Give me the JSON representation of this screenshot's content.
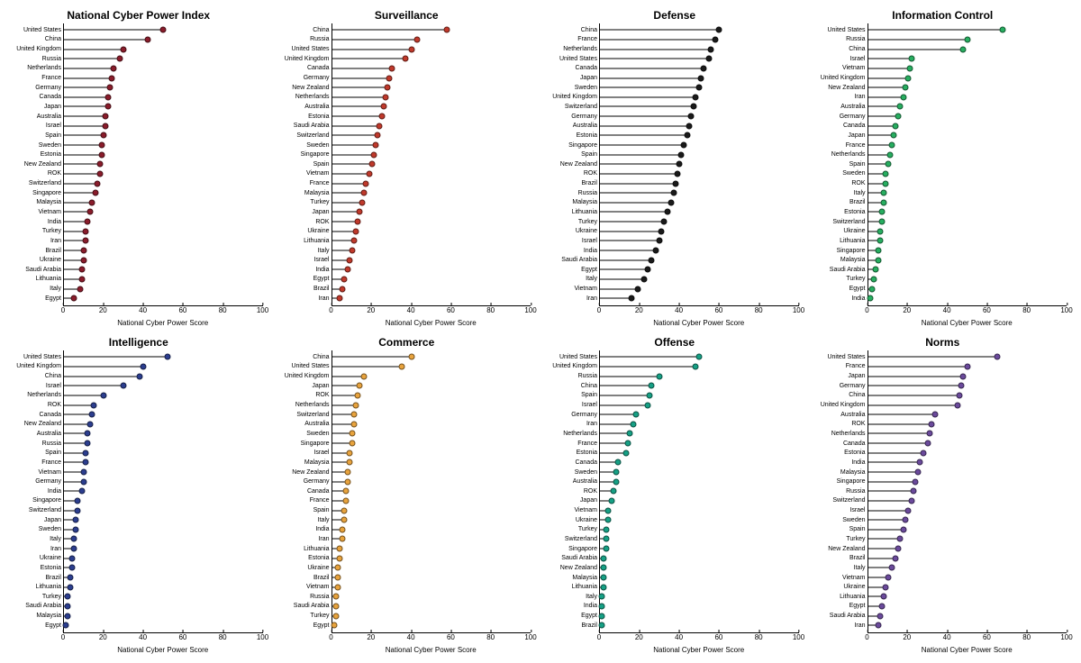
{
  "xlabel": "National Cyber Power Score",
  "xmax": 100,
  "ticks": [
    0,
    20,
    40,
    60,
    80,
    100
  ],
  "chart_data": [
    {
      "title": "National Cyber Power Index",
      "color": "#8a1c2b",
      "type": "lollipop",
      "xlabel": "National Cyber Power Score",
      "xlim": [
        0,
        100
      ],
      "series": [
        {
          "name": "United States",
          "value": 50
        },
        {
          "name": "China",
          "value": 42
        },
        {
          "name": "United Kingdom",
          "value": 30
        },
        {
          "name": "Russia",
          "value": 28
        },
        {
          "name": "Netherlands",
          "value": 25
        },
        {
          "name": "France",
          "value": 24
        },
        {
          "name": "Germany",
          "value": 23
        },
        {
          "name": "Canada",
          "value": 22
        },
        {
          "name": "Japan",
          "value": 22
        },
        {
          "name": "Australia",
          "value": 21
        },
        {
          "name": "Israel",
          "value": 21
        },
        {
          "name": "Spain",
          "value": 20
        },
        {
          "name": "Sweden",
          "value": 19
        },
        {
          "name": "Estonia",
          "value": 19
        },
        {
          "name": "New Zealand",
          "value": 18
        },
        {
          "name": "ROK",
          "value": 18
        },
        {
          "name": "Switzerland",
          "value": 17
        },
        {
          "name": "Singapore",
          "value": 16
        },
        {
          "name": "Malaysia",
          "value": 14
        },
        {
          "name": "Vietnam",
          "value": 13
        },
        {
          "name": "India",
          "value": 12
        },
        {
          "name": "Turkey",
          "value": 11
        },
        {
          "name": "Iran",
          "value": 11
        },
        {
          "name": "Brazil",
          "value": 10
        },
        {
          "name": "Ukraine",
          "value": 10
        },
        {
          "name": "Saudi Arabia",
          "value": 9
        },
        {
          "name": "Lithuania",
          "value": 9
        },
        {
          "name": "Italy",
          "value": 8
        },
        {
          "name": "Egypt",
          "value": 5
        }
      ]
    },
    {
      "title": "Surveillance",
      "color": "#c0392b",
      "type": "lollipop",
      "xlabel": "National Cyber Power Score",
      "xlim": [
        0,
        100
      ],
      "series": [
        {
          "name": "China",
          "value": 58
        },
        {
          "name": "Russia",
          "value": 43
        },
        {
          "name": "United States",
          "value": 40
        },
        {
          "name": "United Kingdom",
          "value": 37
        },
        {
          "name": "Canada",
          "value": 30
        },
        {
          "name": "Germany",
          "value": 29
        },
        {
          "name": "New Zealand",
          "value": 28
        },
        {
          "name": "Netherlands",
          "value": 27
        },
        {
          "name": "Australia",
          "value": 26
        },
        {
          "name": "Estonia",
          "value": 25
        },
        {
          "name": "Saudi Arabia",
          "value": 24
        },
        {
          "name": "Switzerland",
          "value": 23
        },
        {
          "name": "Sweden",
          "value": 22
        },
        {
          "name": "Singapore",
          "value": 21
        },
        {
          "name": "Spain",
          "value": 20
        },
        {
          "name": "Vietnam",
          "value": 19
        },
        {
          "name": "France",
          "value": 17
        },
        {
          "name": "Malaysia",
          "value": 16
        },
        {
          "name": "Turkey",
          "value": 15
        },
        {
          "name": "Japan",
          "value": 14
        },
        {
          "name": "ROK",
          "value": 13
        },
        {
          "name": "Ukraine",
          "value": 12
        },
        {
          "name": "Lithuania",
          "value": 11
        },
        {
          "name": "Italy",
          "value": 10
        },
        {
          "name": "Israel",
          "value": 9
        },
        {
          "name": "India",
          "value": 8
        },
        {
          "name": "Egypt",
          "value": 6
        },
        {
          "name": "Brazil",
          "value": 5
        },
        {
          "name": "Iran",
          "value": 4
        }
      ]
    },
    {
      "title": "Defense",
      "color": "#1a1a1a",
      "type": "lollipop",
      "xlabel": "National Cyber Power Score",
      "xlim": [
        0,
        100
      ],
      "series": [
        {
          "name": "China",
          "value": 60
        },
        {
          "name": "France",
          "value": 58
        },
        {
          "name": "Netherlands",
          "value": 56
        },
        {
          "name": "United States",
          "value": 55
        },
        {
          "name": "Canada",
          "value": 52
        },
        {
          "name": "Japan",
          "value": 51
        },
        {
          "name": "Sweden",
          "value": 50
        },
        {
          "name": "United Kingdom",
          "value": 48
        },
        {
          "name": "Switzerland",
          "value": 47
        },
        {
          "name": "Germany",
          "value": 46
        },
        {
          "name": "Australia",
          "value": 45
        },
        {
          "name": "Estonia",
          "value": 44
        },
        {
          "name": "Singapore",
          "value": 42
        },
        {
          "name": "Spain",
          "value": 41
        },
        {
          "name": "New Zealand",
          "value": 40
        },
        {
          "name": "ROK",
          "value": 39
        },
        {
          "name": "Brazil",
          "value": 38
        },
        {
          "name": "Russia",
          "value": 37
        },
        {
          "name": "Malaysia",
          "value": 36
        },
        {
          "name": "Lithuania",
          "value": 34
        },
        {
          "name": "Turkey",
          "value": 32
        },
        {
          "name": "Ukraine",
          "value": 31
        },
        {
          "name": "Israel",
          "value": 30
        },
        {
          "name": "India",
          "value": 28
        },
        {
          "name": "Saudi Arabia",
          "value": 26
        },
        {
          "name": "Egypt",
          "value": 24
        },
        {
          "name": "Italy",
          "value": 22
        },
        {
          "name": "Vietnam",
          "value": 19
        },
        {
          "name": "Iran",
          "value": 16
        }
      ]
    },
    {
      "title": "Information Control",
      "color": "#27ae60",
      "type": "lollipop",
      "xlabel": "National Cyber Power Score",
      "xlim": [
        0,
        100
      ],
      "series": [
        {
          "name": "United States",
          "value": 68
        },
        {
          "name": "Russia",
          "value": 50
        },
        {
          "name": "China",
          "value": 48
        },
        {
          "name": "Israel",
          "value": 22
        },
        {
          "name": "Vietnam",
          "value": 21
        },
        {
          "name": "United Kingdom",
          "value": 20
        },
        {
          "name": "New Zealand",
          "value": 19
        },
        {
          "name": "Iran",
          "value": 18
        },
        {
          "name": "Australia",
          "value": 16
        },
        {
          "name": "Germany",
          "value": 15
        },
        {
          "name": "Canada",
          "value": 14
        },
        {
          "name": "Japan",
          "value": 13
        },
        {
          "name": "France",
          "value": 12
        },
        {
          "name": "Netherlands",
          "value": 11
        },
        {
          "name": "Spain",
          "value": 10
        },
        {
          "name": "Sweden",
          "value": 9
        },
        {
          "name": "ROK",
          "value": 9
        },
        {
          "name": "Italy",
          "value": 8
        },
        {
          "name": "Brazil",
          "value": 8
        },
        {
          "name": "Estonia",
          "value": 7
        },
        {
          "name": "Switzerland",
          "value": 7
        },
        {
          "name": "Ukraine",
          "value": 6
        },
        {
          "name": "Lithuania",
          "value": 6
        },
        {
          "name": "Singapore",
          "value": 5
        },
        {
          "name": "Malaysia",
          "value": 5
        },
        {
          "name": "Saudi Arabia",
          "value": 4
        },
        {
          "name": "Turkey",
          "value": 3
        },
        {
          "name": "Egypt",
          "value": 2
        },
        {
          "name": "India",
          "value": 1
        }
      ]
    },
    {
      "title": "Intelligence",
      "color": "#2c3e8f",
      "type": "lollipop",
      "xlabel": "National Cyber Power Score",
      "xlim": [
        0,
        100
      ],
      "series": [
        {
          "name": "United States",
          "value": 52
        },
        {
          "name": "United Kingdom",
          "value": 40
        },
        {
          "name": "China",
          "value": 38
        },
        {
          "name": "Israel",
          "value": 30
        },
        {
          "name": "Netherlands",
          "value": 20
        },
        {
          "name": "ROK",
          "value": 15
        },
        {
          "name": "Canada",
          "value": 14
        },
        {
          "name": "New Zealand",
          "value": 13
        },
        {
          "name": "Australia",
          "value": 12
        },
        {
          "name": "Russia",
          "value": 12
        },
        {
          "name": "Spain",
          "value": 11
        },
        {
          "name": "France",
          "value": 11
        },
        {
          "name": "Vietnam",
          "value": 10
        },
        {
          "name": "Germany",
          "value": 10
        },
        {
          "name": "India",
          "value": 9
        },
        {
          "name": "Singapore",
          "value": 7
        },
        {
          "name": "Switzerland",
          "value": 7
        },
        {
          "name": "Japan",
          "value": 6
        },
        {
          "name": "Sweden",
          "value": 6
        },
        {
          "name": "Italy",
          "value": 5
        },
        {
          "name": "Iran",
          "value": 5
        },
        {
          "name": "Ukraine",
          "value": 4
        },
        {
          "name": "Estonia",
          "value": 4
        },
        {
          "name": "Brazil",
          "value": 3
        },
        {
          "name": "Lithuania",
          "value": 3
        },
        {
          "name": "Turkey",
          "value": 2
        },
        {
          "name": "Saudi Arabia",
          "value": 2
        },
        {
          "name": "Malaysia",
          "value": 2
        },
        {
          "name": "Egypt",
          "value": 1
        }
      ]
    },
    {
      "title": "Commerce",
      "color": "#e8a33d",
      "type": "lollipop",
      "xlabel": "National Cyber Power Score",
      "xlim": [
        0,
        100
      ],
      "series": [
        {
          "name": "China",
          "value": 40
        },
        {
          "name": "United States",
          "value": 35
        },
        {
          "name": "United Kingdom",
          "value": 16
        },
        {
          "name": "Japan",
          "value": 14
        },
        {
          "name": "ROK",
          "value": 13
        },
        {
          "name": "Netherlands",
          "value": 12
        },
        {
          "name": "Switzerland",
          "value": 11
        },
        {
          "name": "Australia",
          "value": 11
        },
        {
          "name": "Sweden",
          "value": 10
        },
        {
          "name": "Singapore",
          "value": 10
        },
        {
          "name": "Israel",
          "value": 9
        },
        {
          "name": "Malaysia",
          "value": 9
        },
        {
          "name": "New Zealand",
          "value": 8
        },
        {
          "name": "Germany",
          "value": 8
        },
        {
          "name": "Canada",
          "value": 7
        },
        {
          "name": "France",
          "value": 7
        },
        {
          "name": "Spain",
          "value": 6
        },
        {
          "name": "Italy",
          "value": 6
        },
        {
          "name": "India",
          "value": 5
        },
        {
          "name": "Iran",
          "value": 5
        },
        {
          "name": "Lithuania",
          "value": 4
        },
        {
          "name": "Estonia",
          "value": 4
        },
        {
          "name": "Ukraine",
          "value": 3
        },
        {
          "name": "Brazil",
          "value": 3
        },
        {
          "name": "Vietnam",
          "value": 3
        },
        {
          "name": "Russia",
          "value": 2
        },
        {
          "name": "Saudi Arabia",
          "value": 2
        },
        {
          "name": "Turkey",
          "value": 2
        },
        {
          "name": "Egypt",
          "value": 1
        }
      ]
    },
    {
      "title": "Offense",
      "color": "#16a085",
      "type": "lollipop",
      "xlabel": "National Cyber Power Score",
      "xlim": [
        0,
        100
      ],
      "series": [
        {
          "name": "United States",
          "value": 50
        },
        {
          "name": "United Kingdom",
          "value": 48
        },
        {
          "name": "Russia",
          "value": 30
        },
        {
          "name": "China",
          "value": 26
        },
        {
          "name": "Spain",
          "value": 25
        },
        {
          "name": "Israel",
          "value": 24
        },
        {
          "name": "Germany",
          "value": 18
        },
        {
          "name": "Iran",
          "value": 17
        },
        {
          "name": "Netherlands",
          "value": 15
        },
        {
          "name": "France",
          "value": 14
        },
        {
          "name": "Estonia",
          "value": 13
        },
        {
          "name": "Canada",
          "value": 9
        },
        {
          "name": "Sweden",
          "value": 8
        },
        {
          "name": "Australia",
          "value": 8
        },
        {
          "name": "ROK",
          "value": 7
        },
        {
          "name": "Japan",
          "value": 6
        },
        {
          "name": "Vietnam",
          "value": 4
        },
        {
          "name": "Ukraine",
          "value": 4
        },
        {
          "name": "Turkey",
          "value": 3
        },
        {
          "name": "Switzerland",
          "value": 3
        },
        {
          "name": "Singapore",
          "value": 3
        },
        {
          "name": "Saudi Arabia",
          "value": 2
        },
        {
          "name": "New Zealand",
          "value": 2
        },
        {
          "name": "Malaysia",
          "value": 2
        },
        {
          "name": "Lithuania",
          "value": 2
        },
        {
          "name": "Italy",
          "value": 1
        },
        {
          "name": "India",
          "value": 1
        },
        {
          "name": "Egypt",
          "value": 1
        },
        {
          "name": "Brazil",
          "value": 1
        }
      ]
    },
    {
      "title": "Norms",
      "color": "#6b4a9c",
      "type": "lollipop",
      "xlabel": "National Cyber Power Score",
      "xlim": [
        0,
        100
      ],
      "series": [
        {
          "name": "United States",
          "value": 65
        },
        {
          "name": "France",
          "value": 50
        },
        {
          "name": "Japan",
          "value": 48
        },
        {
          "name": "Germany",
          "value": 47
        },
        {
          "name": "China",
          "value": 46
        },
        {
          "name": "United Kingdom",
          "value": 45
        },
        {
          "name": "Australia",
          "value": 34
        },
        {
          "name": "ROK",
          "value": 32
        },
        {
          "name": "Netherlands",
          "value": 31
        },
        {
          "name": "Canada",
          "value": 30
        },
        {
          "name": "Estonia",
          "value": 28
        },
        {
          "name": "India",
          "value": 26
        },
        {
          "name": "Malaysia",
          "value": 25
        },
        {
          "name": "Singapore",
          "value": 24
        },
        {
          "name": "Russia",
          "value": 23
        },
        {
          "name": "Switzerland",
          "value": 22
        },
        {
          "name": "Israel",
          "value": 20
        },
        {
          "name": "Sweden",
          "value": 19
        },
        {
          "name": "Spain",
          "value": 18
        },
        {
          "name": "Turkey",
          "value": 16
        },
        {
          "name": "New Zealand",
          "value": 15
        },
        {
          "name": "Brazil",
          "value": 14
        },
        {
          "name": "Italy",
          "value": 12
        },
        {
          "name": "Vietnam",
          "value": 10
        },
        {
          "name": "Ukraine",
          "value": 9
        },
        {
          "name": "Lithuania",
          "value": 8
        },
        {
          "name": "Egypt",
          "value": 7
        },
        {
          "name": "Saudi Arabia",
          "value": 6
        },
        {
          "name": "Iran",
          "value": 5
        }
      ]
    }
  ]
}
